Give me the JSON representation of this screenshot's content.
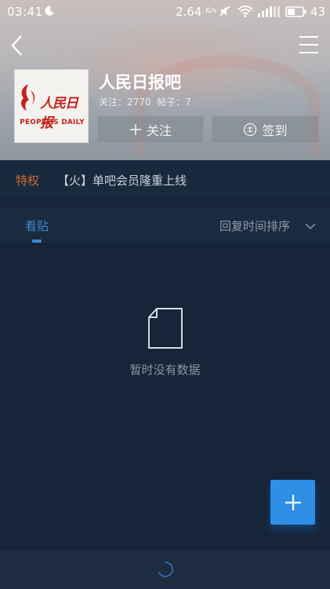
{
  "status_bar": {
    "time": "03:41",
    "net_speed": "2.64",
    "net_speed_unit": "K/s",
    "battery_level": "43",
    "icons": [
      "moon-icon",
      "mute-icon",
      "wifi-icon",
      "signal-icon",
      "battery-icon"
    ]
  },
  "header": {
    "back_icon": "chevron-left-icon",
    "menu_icon": "hamburger-menu-icon",
    "logo": {
      "cn_text": "人民日报",
      "en_text": "PEOPLE'S DAILY",
      "brand_color": "#c3241d"
    },
    "forum_name": "人民日报吧",
    "stats_text": "关注：2770  帖子：7",
    "follow_label": "关注",
    "signin_label": "签到"
  },
  "privilege": {
    "label": "特权",
    "text": "【火】单吧会员隆重上线",
    "label_color": "#d06a3a"
  },
  "tabs": {
    "active_label": "看贴",
    "sort_label": "回复时间排序",
    "accent_color": "#3f86d0"
  },
  "empty_state": {
    "icon": "document-icon",
    "message": "暂时没有数据"
  },
  "fab": {
    "icon": "plus-icon",
    "color": "#2f8ee6"
  },
  "bottom_bar": {
    "icon": "loading-spinner-icon"
  }
}
